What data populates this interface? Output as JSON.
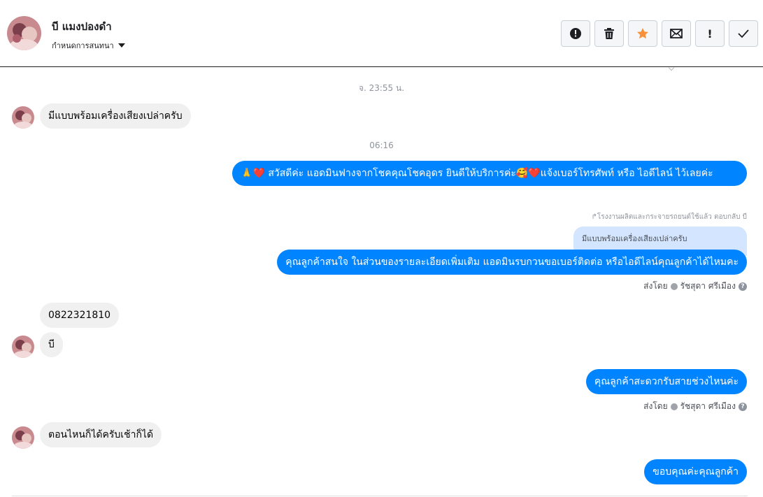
{
  "header": {
    "name": "บี แมงปองดำ",
    "subtitle": "กำหนดการสนทนา",
    "actions": [
      {
        "icon": "alert-circle-icon"
      },
      {
        "icon": "trash-icon"
      },
      {
        "icon": "star-icon"
      },
      {
        "icon": "envelope-icon"
      },
      {
        "icon": "exclamation-icon",
        "label": "!"
      },
      {
        "icon": "checkmark-icon"
      }
    ]
  },
  "colors": {
    "accent": "#0084ff",
    "star": "#f7923b",
    "incoming_bg": "#f0f0f0",
    "quote_bg": "#d3e5ff"
  },
  "thread": {
    "ts1": "จ. 23:55 น.",
    "msg1": "มีแบบพร้อมเครื่องเสียงเปล่าครับ",
    "ts2": "06:16",
    "out1_emoji1": "🙏",
    "out1_emoji2": "❤️",
    "out1_text": "สวัสดีค่ะ แอดมินฟางจากโชคคุณโชคอุดร ยินดีให้บริการค่ะ🥰❤️แจ้งเบอร์โทรศัพท์ หรือ ไอดีไลน์  ไว้เลยค่ะ",
    "reply_note": "โรงงานผลิตและกระจายรถยนต์ใช้แล้ว ตอบกลับ บี",
    "quote": "มีแบบพร้อมเครื่องเสียงเปล่าครับ",
    "out2": "คุณลูกค้าสนใจ ในส่วนของรายละเอียดเพิ่มเติม แอดมินรบกวนขอเบอร์ติดต่อ หรือไอดีไลน์คุณลูกค้าได้ไหมคะ",
    "sent_by_label": "ส่งโดย",
    "sender": "รัชสุดา ศรีเมือง",
    "help": "?",
    "in_phone": "0822321810",
    "in_b": "บี",
    "out3": "คุณลูกค้าสะดวกรับสายช่วงไหนค่ะ",
    "in_time": "ตอนไหนก็ได้ครับเช้าก็ได้",
    "out4": "ขอบคุณค่ะคุณลูกค้า"
  }
}
